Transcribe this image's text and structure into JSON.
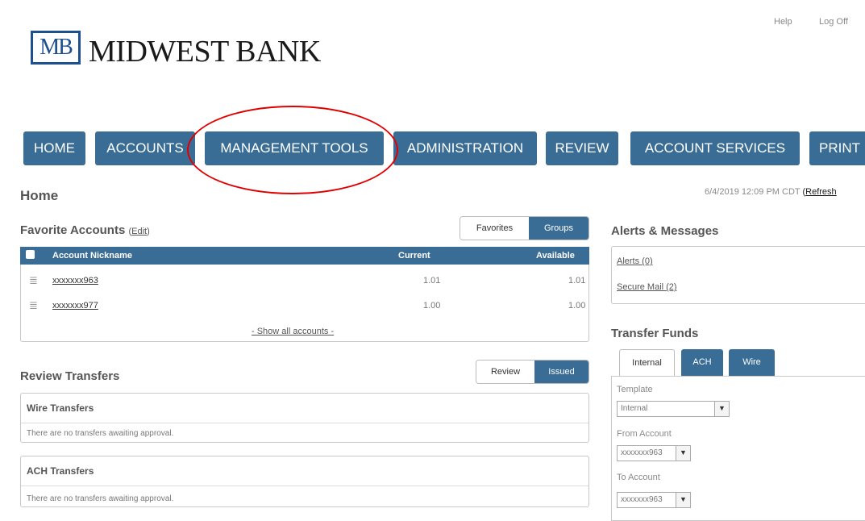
{
  "header": {
    "logo_mark": "MB",
    "bank_name": "MIDWEST BANK",
    "help_label": "Help",
    "logoff_label": "Log Off"
  },
  "nav": {
    "items": [
      "HOME",
      "ACCOUNTS",
      "MANAGEMENT TOOLS",
      "ADMINISTRATION",
      "REVIEW",
      "ACCOUNT SERVICES",
      "PRINT"
    ]
  },
  "page": {
    "title": "Home",
    "timestamp": "6/4/2019 12:09 PM CDT",
    "refresh_label": "Refresh"
  },
  "favorites": {
    "title": "Favorite Accounts",
    "edit_label": "Edit",
    "toggle": [
      "Favorites",
      "Groups"
    ],
    "columns": [
      "Account Nickname",
      "Current",
      "Available"
    ],
    "rows": [
      {
        "nickname": "xxxxxxx963",
        "current": "1.01",
        "available": "1.01"
      },
      {
        "nickname": "xxxxxxx977",
        "current": "1.00",
        "available": "1.00"
      }
    ],
    "show_all_label": "- Show all accounts -"
  },
  "review_transfers": {
    "title": "Review Transfers",
    "toggle": [
      "Review",
      "Issued"
    ],
    "sections": [
      {
        "title": "Wire Transfers",
        "message": "There are no transfers awaiting approval."
      },
      {
        "title": "ACH Transfers",
        "message": "There are no transfers awaiting approval."
      }
    ]
  },
  "alerts": {
    "title": "Alerts & Messages",
    "items": [
      "Alerts (0)",
      "Secure Mail (2)"
    ]
  },
  "transfer_funds": {
    "title": "Transfer Funds",
    "tabs": [
      "Internal",
      "ACH",
      "Wire"
    ],
    "template_label": "Template",
    "template_value": "Internal",
    "from_label": "From Account",
    "from_value": "xxxxxxx963",
    "to_label": "To Account",
    "to_value": "xxxxxxx963"
  },
  "colors": {
    "nav_blue": "#3a6d95",
    "brand_blue": "#1d4f91",
    "highlight_red": "#e00000"
  }
}
